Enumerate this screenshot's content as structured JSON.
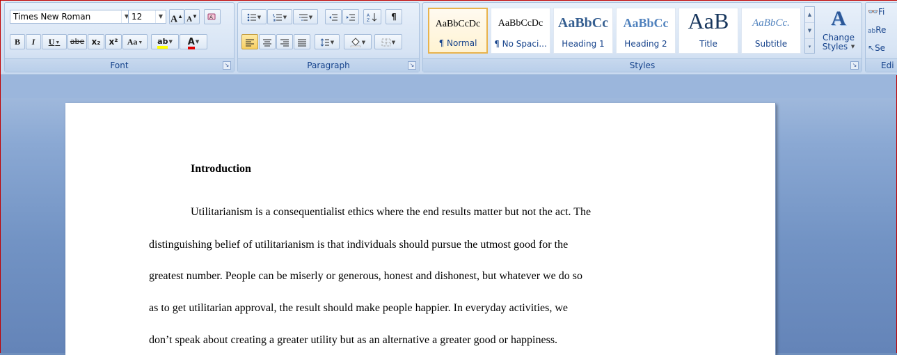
{
  "font_group": {
    "font_name": "Times New Roman",
    "font_size": "12",
    "grow_font": "A",
    "shrink_font": "A",
    "bold": "B",
    "italic": "I",
    "underline": "U",
    "strikethrough": "abe",
    "subscript": "x₂",
    "superscript": "x²",
    "change_case": "Aa",
    "highlight": "ab",
    "font_color": "A",
    "label": "Font"
  },
  "paragraph_group": {
    "show_hide": "¶",
    "label": "Paragraph"
  },
  "styles_group": {
    "label": "Styles",
    "tiles": [
      {
        "sample": "AaBbCcDc",
        "name": "¶ Normal"
      },
      {
        "sample": "AaBbCcDc",
        "name": "¶ No Spaci..."
      },
      {
        "sample": "AaBbCc",
        "name": "Heading 1"
      },
      {
        "sample": "AaBbCc",
        "name": "Heading 2"
      },
      {
        "sample": "AaB",
        "name": "Title"
      },
      {
        "sample": "AaBbCc.",
        "name": "Subtitle"
      }
    ],
    "change_styles_line1": "Change",
    "change_styles_line2": "Styles"
  },
  "editing_group": {
    "find": "Fi",
    "replace": "Re",
    "select": "Se",
    "label": "Edi"
  },
  "document": {
    "heading": "Introduction",
    "lines": [
      "Utilitarianism is a consequentialist ethics where the end results matter but not the act. The",
      "distinguishing belief of utilitarianism is that individuals should pursue the utmost good for the",
      "greatest number. People can be miserly or generous, honest and dishonest, but whatever we do so",
      "as to get utilitarian approval, the result should make people happier. In everyday activities, we",
      "don’t speak about creating a greater utility but as an alternative a greater good or happiness."
    ]
  },
  "colors": {
    "ribbon_label": "#15428b",
    "selected_style_border": "#e8b34d",
    "font_color_bar": "#e00000",
    "highlight_bar": "#ffff00",
    "heading1_color": "#365f91"
  }
}
